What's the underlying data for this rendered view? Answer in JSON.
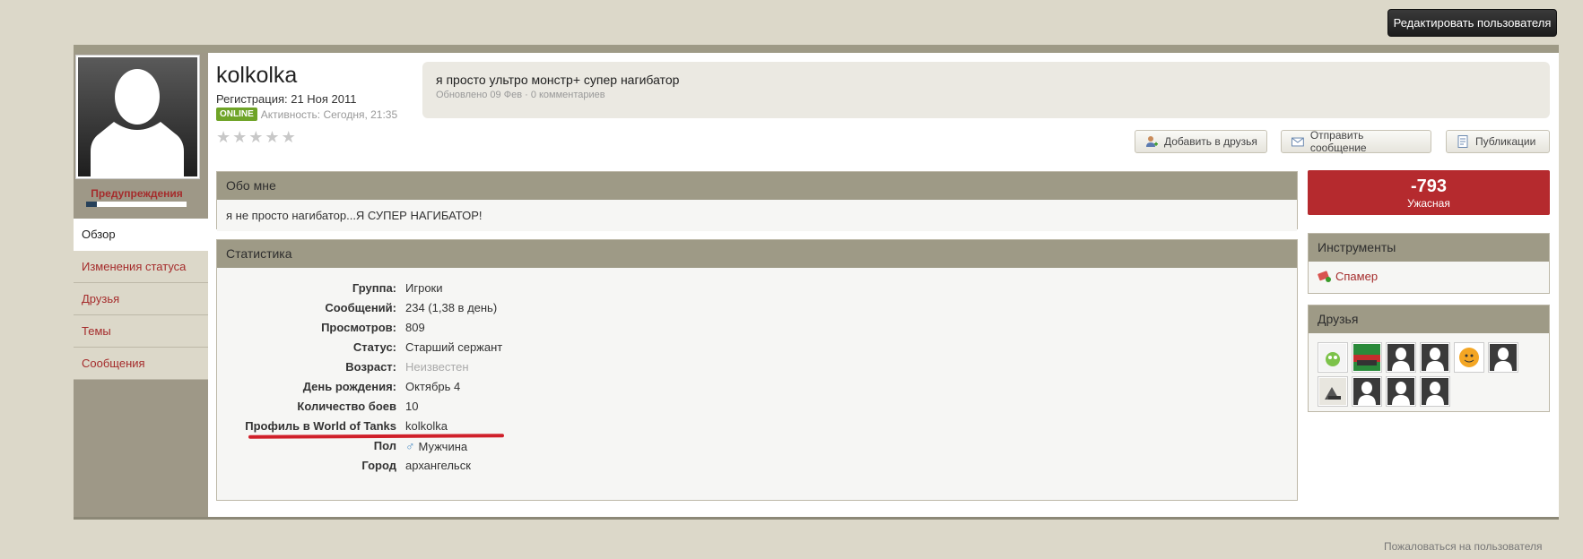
{
  "header": {
    "edit_button": "Редактировать пользователя"
  },
  "profile": {
    "username": "kolkolka",
    "registration": "Регистрация: 21 Ноя 2011",
    "online_badge": "ONLINE",
    "activity": "Активность: Сегодня, 21:35",
    "rating_stars": 0,
    "warnings_label": "Предупреждения"
  },
  "status": {
    "text": "я просто ультро монстр+ супер нагибатор",
    "meta": "Обновлено 09 Фев · 0 комментариев"
  },
  "actions": {
    "add_friend": "Добавить в друзья",
    "send_message": "Отправить сообщение",
    "publications": "Публикации"
  },
  "nav": {
    "items": [
      {
        "label": "Обзор",
        "active": true
      },
      {
        "label": "Изменения статуса",
        "active": false
      },
      {
        "label": "Друзья",
        "active": false
      },
      {
        "label": "Темы",
        "active": false
      },
      {
        "label": "Сообщения",
        "active": false
      }
    ]
  },
  "about": {
    "title": "Обо мне",
    "text": "я не просто нагибатор...Я СУПЕР НАГИБАТОР!"
  },
  "stats": {
    "title": "Статистика",
    "rows": [
      {
        "label": "Группа:",
        "value": "Игроки"
      },
      {
        "label": "Сообщений:",
        "value": "234 (1,38 в день)"
      },
      {
        "label": "Просмотров:",
        "value": "809"
      },
      {
        "label": "Статус:",
        "value": "Старший сержант"
      },
      {
        "label": "Возраст:",
        "value": "Неизвестен"
      },
      {
        "label": "День рождения:",
        "value": "Октябрь 4"
      },
      {
        "label": "Количество боев",
        "value": "10"
      },
      {
        "label": "Профиль в World of Tanks",
        "value": "kolkolka"
      },
      {
        "label": "Пол",
        "value": "Мужчина"
      },
      {
        "label": "Город",
        "value": "архангельск"
      }
    ]
  },
  "reputation": {
    "value": "-793",
    "label": "Ужасная",
    "color": "#b52a2e"
  },
  "tools": {
    "title": "Инструменты",
    "spammer": "Спамер"
  },
  "friends": {
    "title": "Друзья",
    "count_shown": 10
  },
  "footer": {
    "report": "Пожаловаться на пользователя"
  },
  "colors": {
    "accent_link": "#a52c2c",
    "panel_header": "#9e9a86",
    "online": "#6fa428",
    "background": "#dcd8c9"
  }
}
